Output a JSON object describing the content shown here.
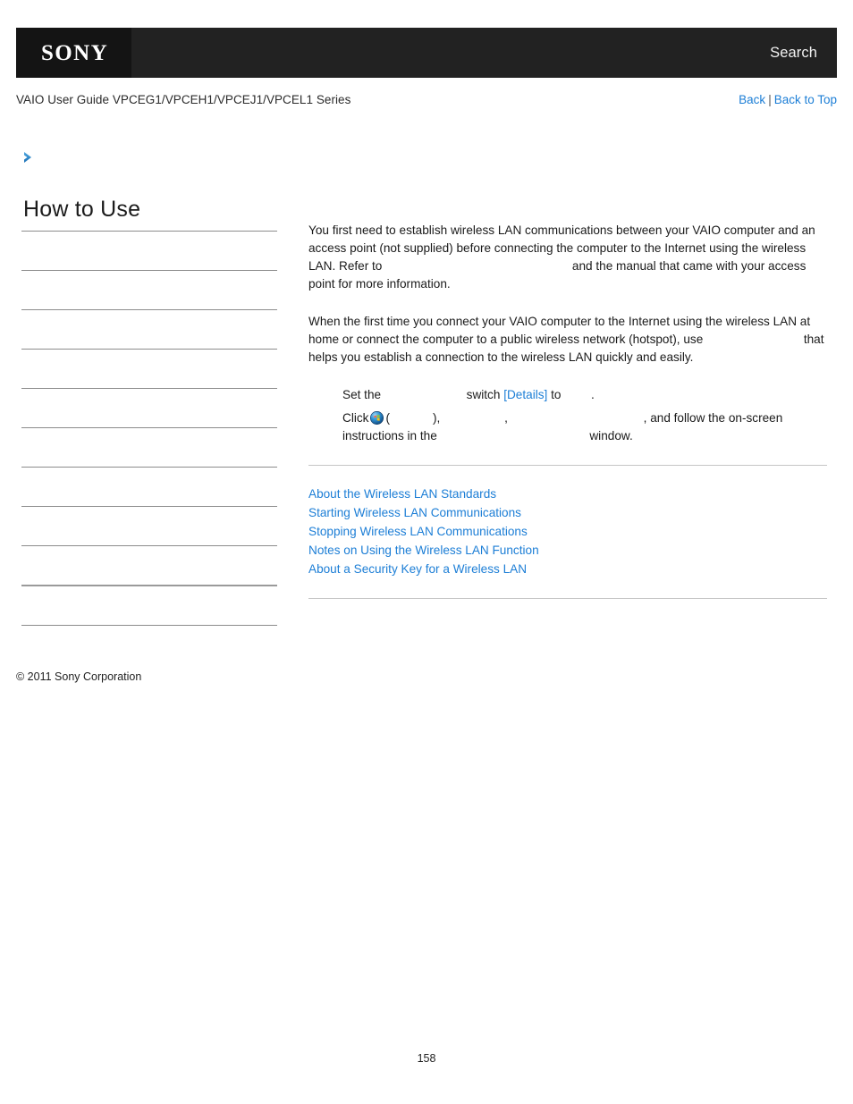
{
  "header": {
    "logo": "SONY",
    "search_label": "Search"
  },
  "sub_header": {
    "guide_title": "VAIO User Guide VPCEG1/VPCEH1/VPCEJ1/VPCEL1 Series",
    "back_label": "Back",
    "separator": "|",
    "back_to_top_label": "Back to Top"
  },
  "sidebar": {
    "heading": "How to Use",
    "items": [
      {
        "label": ""
      },
      {
        "label": ""
      },
      {
        "label": ""
      },
      {
        "label": ""
      },
      {
        "label": ""
      },
      {
        "label": ""
      },
      {
        "label": ""
      },
      {
        "label": ""
      },
      {
        "label": ""
      },
      {
        "label": ""
      },
      {
        "label": ""
      }
    ],
    "copyright": "© 2011 Sony Corporation"
  },
  "main": {
    "paragraph1": {
      "part1": "You first need to establish wireless LAN communications between your VAIO computer and an access point (not supplied) before connecting the computer to the Internet using the wireless LAN. Refer to",
      "link": "",
      "part2": "and the manual that came with your access point for more information."
    },
    "paragraph2": {
      "part1": "When the first time you connect your VAIO computer to the Internet using the wireless LAN at home or connect the computer to a public wireless network (hotspot), use",
      "link": "",
      "part2": "that helps you establish a connection to the wireless LAN quickly and easily."
    },
    "steps": [
      {
        "text1": "Set the",
        "value1": "",
        "text2": "switch",
        "details_link": "[Details]",
        "text3": "to",
        "value2": "",
        "text4": "."
      },
      {
        "text1": "Click",
        "icon": "windows-start-orb-icon",
        "text2": "(",
        "value1": "",
        "text3": "),",
        "value2": "",
        "text4": ",",
        "value3": "",
        "text5": ", and follow the on-screen instructions in the",
        "value4": "",
        "text6": "window."
      }
    ],
    "related_links": [
      "About the Wireless LAN Standards",
      "Starting Wireless LAN Communications",
      "Stopping Wireless LAN Communications",
      "Notes on Using the Wireless LAN Function",
      "About a Security Key for a Wireless LAN"
    ]
  },
  "footer": {
    "page_number": "158"
  },
  "colors": {
    "link_blue": "#1c7ed6",
    "header_dark": "#222222",
    "logo_block": "#141414",
    "rule_gray": "#8c8c8c"
  }
}
